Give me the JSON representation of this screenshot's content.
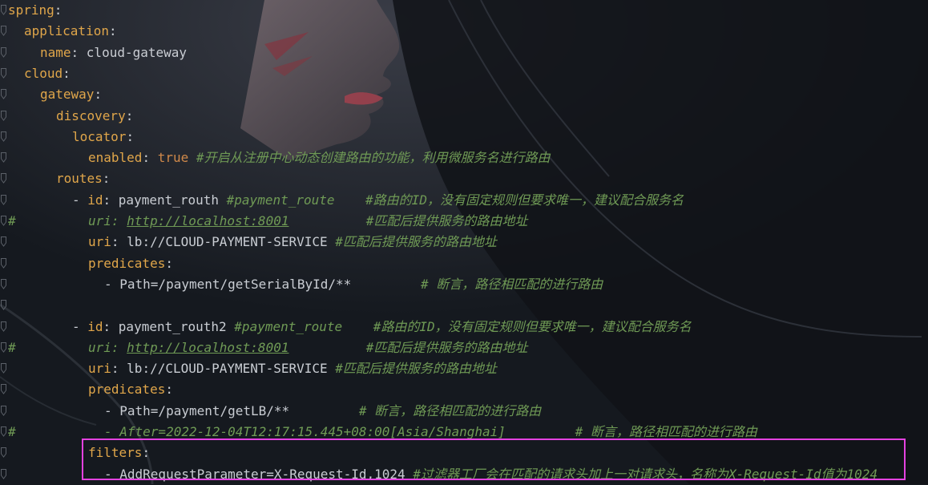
{
  "editor": {
    "lines": [
      {
        "indent": 0,
        "key": "spring",
        "sep": ":"
      },
      {
        "indent": 2,
        "key": "application",
        "sep": ":"
      },
      {
        "indent": 4,
        "key": "name",
        "sep": ": ",
        "value": "cloud-gateway"
      },
      {
        "indent": 2,
        "key": "cloud",
        "sep": ":"
      },
      {
        "indent": 4,
        "key": "gateway",
        "sep": ":"
      },
      {
        "indent": 6,
        "key": "discovery",
        "sep": ":"
      },
      {
        "indent": 8,
        "key": "locator",
        "sep": ":"
      },
      {
        "indent": 10,
        "key": "enabled",
        "sep": ": ",
        "keyword": "true",
        "comment": " #开启从注册中心动态创建路由的功能，利用微服务名进行路由"
      },
      {
        "indent": 6,
        "key": "routes",
        "sep": ":"
      },
      {
        "indent": 8,
        "dash": "- ",
        "key": "id",
        "sep": ": ",
        "value": "payment_routh ",
        "comment": "#payment_route    #路由的ID，没有固定规则但要求唯一，建议配合服务名"
      },
      {
        "hash": "#",
        "indent": 10,
        "comment_italic": "uri: ",
        "url": "http://localhost:8001",
        "comment": "          #匹配后提供服务的路由地址"
      },
      {
        "indent": 10,
        "key": "uri",
        "sep": ": ",
        "value": "lb://CLOUD-PAYMENT-SERVICE ",
        "comment": "#匹配后提供服务的路由地址"
      },
      {
        "indent": 10,
        "key": "predicates",
        "sep": ":"
      },
      {
        "indent": 12,
        "dash": "- ",
        "value": "Path=/payment/getSerialById/**",
        "comment": "         # 断言，路径相匹配的进行路由"
      },
      {
        "indent": 0
      },
      {
        "indent": 8,
        "dash": "- ",
        "key": "id",
        "sep": ": ",
        "value": "payment_routh2 ",
        "comment": "#payment_route    #路由的ID，没有固定规则但要求唯一，建议配合服务名"
      },
      {
        "hash": "#",
        "indent": 10,
        "comment_italic": "uri: ",
        "url": "http://localhost:8001",
        "comment": "          #匹配后提供服务的路由地址"
      },
      {
        "indent": 10,
        "key": "uri",
        "sep": ": ",
        "value": "lb://CLOUD-PAYMENT-SERVICE ",
        "comment": "#匹配后提供服务的路由地址"
      },
      {
        "indent": 10,
        "key": "predicates",
        "sep": ":"
      },
      {
        "indent": 12,
        "dash": "- ",
        "value": "Path=/payment/getLB/**",
        "comment": "         # 断言，路径相匹配的进行路由"
      },
      {
        "hash": "#",
        "indent": 12,
        "comment_italic": "- After=2022-12-04T12:17:15.445+08:00[Asia/Shanghai]",
        "comment": "         # 断言，路径相匹配的进行路由"
      },
      {
        "indent": 10,
        "key": "filters",
        "sep": ":"
      },
      {
        "indent": 12,
        "dash": "- ",
        "value": "AddRequestParameter=X-Request-Id,1024 ",
        "comment": "#过滤器工厂会在匹配的请求头加上一对请求头，名称为X-Request-Id值为1024"
      }
    ]
  },
  "colors": {
    "key": "#e0a64a",
    "comment": "#6f9a55",
    "highlight_box": "#e442e0"
  },
  "highlight": {
    "from_line": 21,
    "to_line": 22
  }
}
